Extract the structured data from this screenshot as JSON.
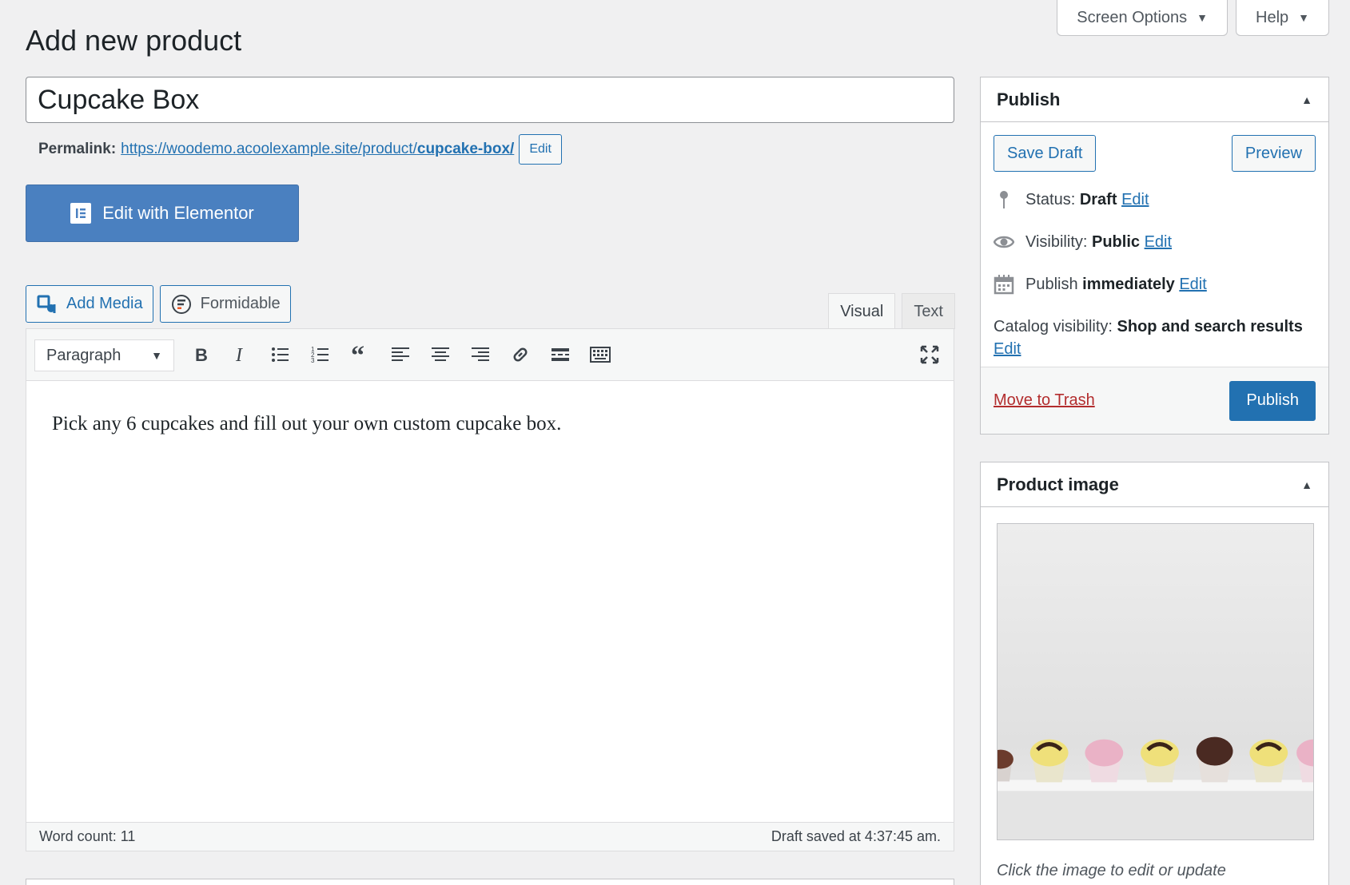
{
  "top_tabs": {
    "screen_options": "Screen Options",
    "help": "Help"
  },
  "page_title": "Add new product",
  "product": {
    "title": "Cupcake Box",
    "permalink_label": "Permalink:",
    "permalink_base": "https://woodemo.acoolexample.site/product/",
    "permalink_slug": "cupcake-box/",
    "permalink_edit": "Edit"
  },
  "elementor": {
    "label": "Edit with Elementor"
  },
  "media_buttons": {
    "add_media": "Add Media",
    "formidable": "Formidable"
  },
  "editor_tabs": {
    "visual": "Visual",
    "text": "Text"
  },
  "editor": {
    "format": "Paragraph",
    "content": "Pick any 6 cupcakes and fill out your own custom cupcake box.",
    "word_count": "Word count: 11",
    "draft_saved": "Draft saved at 4:37:45 am."
  },
  "publish_box": {
    "title": "Publish",
    "save_draft": "Save Draft",
    "preview": "Preview",
    "status_label": "Status:",
    "status_value": "Draft",
    "visibility_label": "Visibility:",
    "visibility_value": "Public",
    "publish_label": "Publish",
    "publish_value": "immediately",
    "catalog_label": "Catalog visibility:",
    "catalog_value": "Shop and search results",
    "edit": "Edit",
    "move_to_trash": "Move to Trash",
    "publish_button": "Publish"
  },
  "product_image": {
    "title": "Product image",
    "caption": "Click the image to edit or update"
  },
  "colors": {
    "primary": "#2271b1",
    "elementor": "#4a80c0",
    "trash": "#b32d2e",
    "background": "#f0f0f1"
  }
}
